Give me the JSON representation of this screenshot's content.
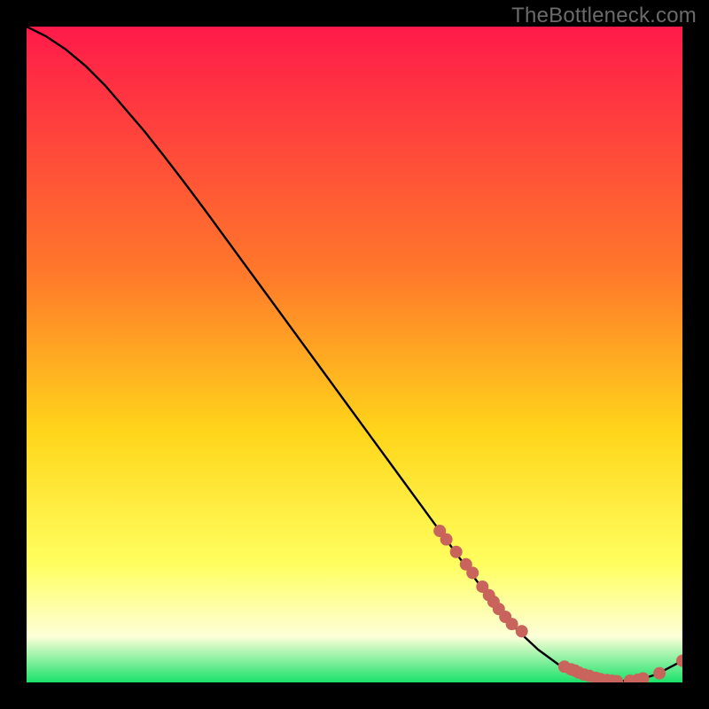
{
  "watermark": "TheBottleneck.com",
  "colors": {
    "black": "#000000",
    "linecolor": "#000000",
    "marker_fill": "#c9645d",
    "marker_stroke": "#a24a45",
    "grad_top": "#ff1a4a",
    "grad_mid1": "#ff7a2a",
    "grad_mid2": "#ffd61a",
    "grad_mid3": "#ffff60",
    "grad_mid4": "#fdffd8",
    "grad_bottom": "#1ae26a"
  },
  "chart_data": {
    "type": "line",
    "title": "",
    "xlabel": "",
    "ylabel": "",
    "xlim": [
      0,
      100
    ],
    "ylim": [
      0,
      100
    ],
    "series": [
      {
        "name": "bottleneck-curve",
        "x": [
          0,
          3,
          6,
          9,
          12,
          15,
          18,
          21,
          24,
          27,
          30,
          33,
          36,
          39,
          42,
          45,
          48,
          51,
          54,
          57,
          60,
          63,
          66,
          69,
          72,
          75,
          78,
          81,
          84,
          87,
          90,
          93,
          96,
          100
        ],
        "y": [
          100,
          98.5,
          96.5,
          94,
          91,
          87.5,
          84,
          80.2,
          76.3,
          72.3,
          68.2,
          64.1,
          60,
          55.9,
          51.8,
          47.7,
          43.6,
          39.5,
          35.4,
          31.3,
          27.2,
          23.1,
          19,
          15,
          11.2,
          7.8,
          5,
          2.8,
          1.4,
          0.6,
          0.2,
          0.3,
          1.2,
          3.3
        ]
      }
    ],
    "markers": {
      "name": "highlighted-points",
      "x": [
        63,
        64,
        65.5,
        67,
        68,
        69.5,
        70.5,
        71.2,
        72,
        73,
        74,
        75.5,
        82,
        83,
        83.6,
        84.2,
        85,
        85.8,
        86.8,
        87.5,
        88.5,
        89.3,
        90,
        92,
        93.2,
        94,
        96.5,
        100
      ],
      "y": [
        23.1,
        21.8,
        19.9,
        18,
        16.7,
        14.6,
        13.3,
        12.3,
        11.2,
        10,
        8.9,
        7.8,
        2.4,
        2,
        1.8,
        1.5,
        1.2,
        1.0,
        0.7,
        0.5,
        0.35,
        0.25,
        0.2,
        0.25,
        0.4,
        0.6,
        1.4,
        3.3
      ]
    }
  }
}
